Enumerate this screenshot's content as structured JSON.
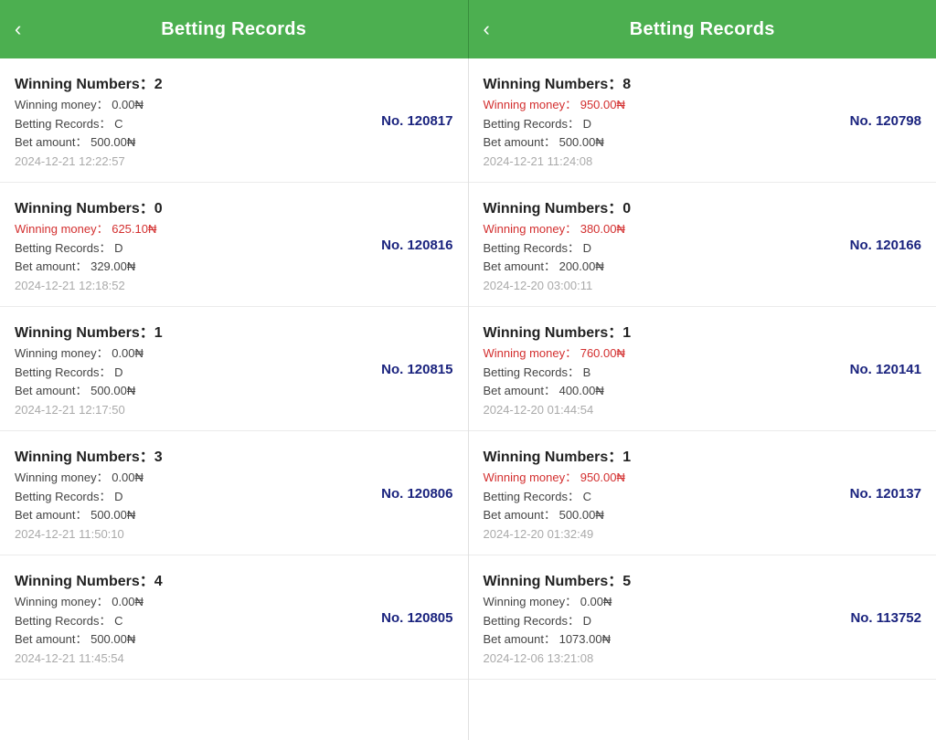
{
  "left_header": {
    "title": "Betting Records",
    "back_icon": "‹"
  },
  "right_header": {
    "title": "Betting Records",
    "back_icon": "‹"
  },
  "left_records": [
    {
      "winning_numbers_label": "Winning Numbers：",
      "winning_number": "2",
      "winning_money_label": "Winning money：",
      "winning_money": "0.00₦",
      "winning_money_highlight": false,
      "betting_records_label": "Betting Records：",
      "betting_records": "C",
      "bet_amount_label": "Bet amount：",
      "bet_amount": "500.00₦",
      "timestamp": "2024-12-21 12:22:57",
      "record_number": "No. 120817"
    },
    {
      "winning_numbers_label": "Winning Numbers：",
      "winning_number": "0",
      "winning_money_label": "Winning money：",
      "winning_money": "625.10₦",
      "winning_money_highlight": true,
      "betting_records_label": "Betting Records：",
      "betting_records": "D",
      "bet_amount_label": "Bet amount：",
      "bet_amount": "329.00₦",
      "timestamp": "2024-12-21 12:18:52",
      "record_number": "No. 120816"
    },
    {
      "winning_numbers_label": "Winning Numbers：",
      "winning_number": "1",
      "winning_money_label": "Winning money：",
      "winning_money": "0.00₦",
      "winning_money_highlight": false,
      "betting_records_label": "Betting Records：",
      "betting_records": "D",
      "bet_amount_label": "Bet amount：",
      "bet_amount": "500.00₦",
      "timestamp": "2024-12-21 12:17:50",
      "record_number": "No. 120815"
    },
    {
      "winning_numbers_label": "Winning Numbers：",
      "winning_number": "3",
      "winning_money_label": "Winning money：",
      "winning_money": "0.00₦",
      "winning_money_highlight": false,
      "betting_records_label": "Betting Records：",
      "betting_records": "D",
      "bet_amount_label": "Bet amount：",
      "bet_amount": "500.00₦",
      "timestamp": "2024-12-21 11:50:10",
      "record_number": "No. 120806"
    },
    {
      "winning_numbers_label": "Winning Numbers：",
      "winning_number": "4",
      "winning_money_label": "Winning money：",
      "winning_money": "0.00₦",
      "winning_money_highlight": false,
      "betting_records_label": "Betting Records：",
      "betting_records": "C",
      "bet_amount_label": "Bet amount：",
      "bet_amount": "500.00₦",
      "timestamp": "2024-12-21 11:45:54",
      "record_number": "No. 120805"
    }
  ],
  "right_records": [
    {
      "winning_numbers_label": "Winning Numbers：",
      "winning_number": "8",
      "winning_money_label": "Winning money：",
      "winning_money": "950.00₦",
      "winning_money_highlight": true,
      "betting_records_label": "Betting Records：",
      "betting_records": "D",
      "bet_amount_label": "Bet amount：",
      "bet_amount": "500.00₦",
      "timestamp": "2024-12-21 11:24:08",
      "record_number": "No. 120798"
    },
    {
      "winning_numbers_label": "Winning Numbers：",
      "winning_number": "0",
      "winning_money_label": "Winning money：",
      "winning_money": "380.00₦",
      "winning_money_highlight": true,
      "betting_records_label": "Betting Records：",
      "betting_records": "D",
      "bet_amount_label": "Bet amount：",
      "bet_amount": "200.00₦",
      "timestamp": "2024-12-20 03:00:11",
      "record_number": "No. 120166"
    },
    {
      "winning_numbers_label": "Winning Numbers：",
      "winning_number": "1",
      "winning_money_label": "Winning money：",
      "winning_money": "760.00₦",
      "winning_money_highlight": true,
      "betting_records_label": "Betting Records：",
      "betting_records": "B",
      "bet_amount_label": "Bet amount：",
      "bet_amount": "400.00₦",
      "timestamp": "2024-12-20 01:44:54",
      "record_number": "No. 120141"
    },
    {
      "winning_numbers_label": "Winning Numbers：",
      "winning_number": "1",
      "winning_money_label": "Winning money：",
      "winning_money": "950.00₦",
      "winning_money_highlight": true,
      "betting_records_label": "Betting Records：",
      "betting_records": "C",
      "bet_amount_label": "Bet amount：",
      "bet_amount": "500.00₦",
      "timestamp": "2024-12-20 01:32:49",
      "record_number": "No. 120137"
    },
    {
      "winning_numbers_label": "Winning Numbers：",
      "winning_number": "5",
      "winning_money_label": "Winning money：",
      "winning_money": "0.00₦",
      "winning_money_highlight": false,
      "betting_records_label": "Betting Records：",
      "betting_records": "D",
      "bet_amount_label": "Bet amount：",
      "bet_amount": "1073.00₦",
      "timestamp": "2024-12-06 13:21:08",
      "record_number": "No. 113752"
    }
  ]
}
